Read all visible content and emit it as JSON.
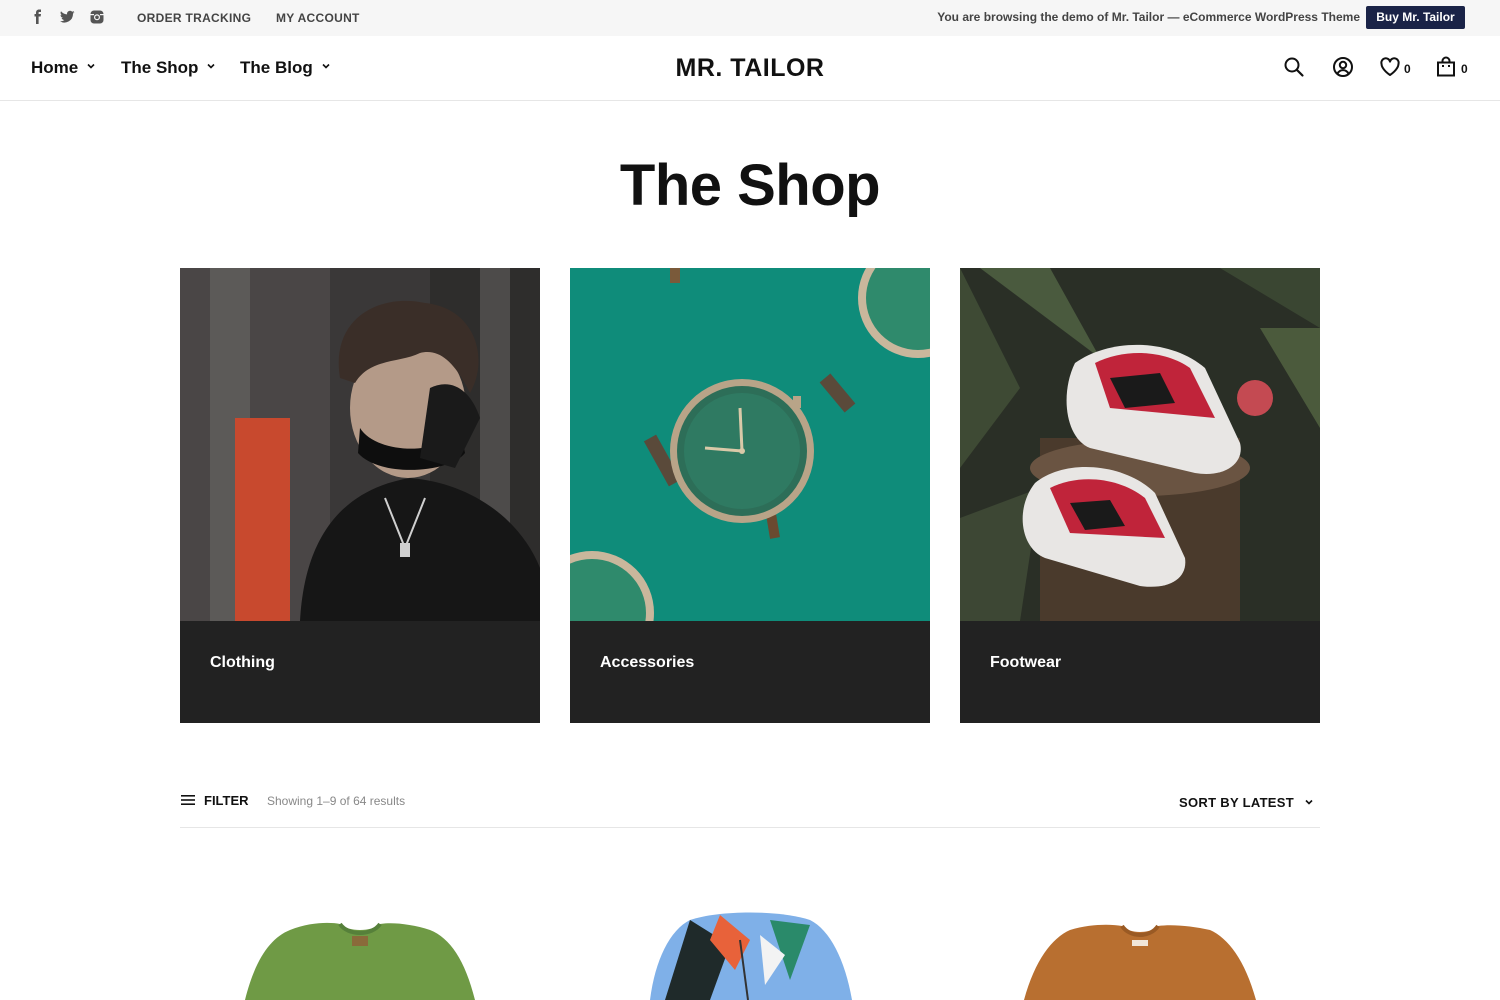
{
  "topbar": {
    "social_icons": [
      "facebook-icon",
      "twitter-icon",
      "instagram-icon"
    ],
    "links": [
      "ORDER TRACKING",
      "MY ACCOUNT"
    ],
    "demo_text": "You are browsing the demo of  Mr. Tailor — eCommerce WordPress Theme",
    "buy_button": "Buy Mr. Tailor"
  },
  "header": {
    "nav": [
      "Home",
      "The Shop",
      "The Blog"
    ],
    "logo": "MR. TAILOR",
    "wishlist_count": "0",
    "cart_count": "0"
  },
  "page": {
    "title": "The Shop"
  },
  "categories": [
    {
      "label": "Clothing"
    },
    {
      "label": "Accessories"
    },
    {
      "label": "Footwear"
    }
  ],
  "toolbar": {
    "filter_label": "FILTER",
    "results_text": "Showing 1–9 of 64 results",
    "sort_label": "SORT BY LATEST"
  },
  "colors": {
    "buy_button_bg": "#1a2347",
    "category_bar_bg": "#222222",
    "topbar_bg": "#f6f6f6"
  }
}
